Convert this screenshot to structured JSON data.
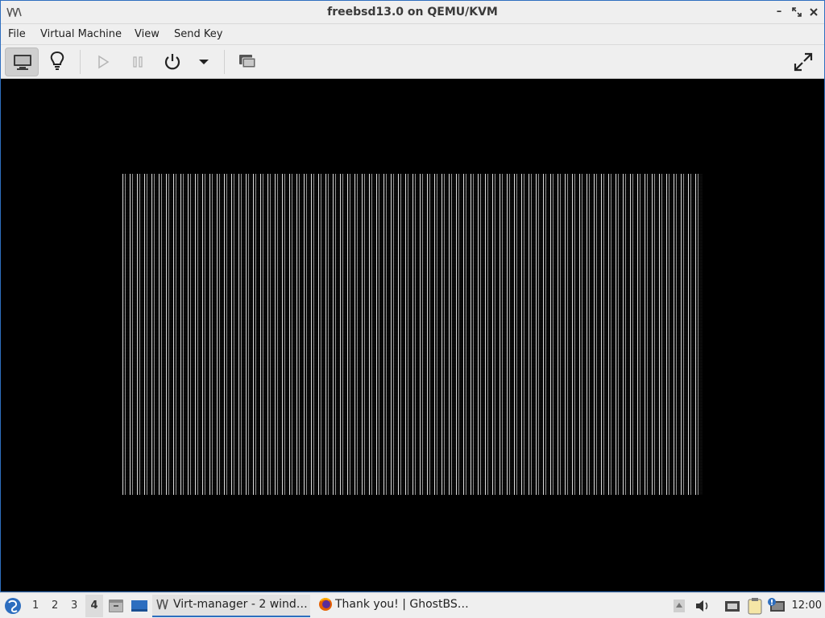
{
  "window": {
    "title": "freebsd13.0 on QEMU/KVM"
  },
  "menu": {
    "items": [
      "File",
      "Virtual Machine",
      "View",
      "Send Key"
    ]
  },
  "toolbar": {
    "buttons": [
      "console-icon",
      "lightbulb-icon",
      "play-icon",
      "pause-icon",
      "power-icon",
      "dropdown-arrow-icon",
      "snapshots-icon",
      "fullscreen-icon"
    ]
  },
  "taskbar": {
    "workspaces": [
      "1",
      "2",
      "3",
      "4"
    ],
    "active_workspace": "4",
    "tasks": [
      {
        "label": "Virt-manager - 2 wind…",
        "icon": "virt-manager-icon",
        "active": true
      },
      {
        "label": "Thank you! | GhostBS…",
        "icon": "firefox-icon",
        "active": false
      }
    ],
    "clock": "12:00"
  },
  "colors": {
    "accent": "#2d6ebf",
    "console_bg": "#000000",
    "chrome_bg": "#efefef"
  }
}
